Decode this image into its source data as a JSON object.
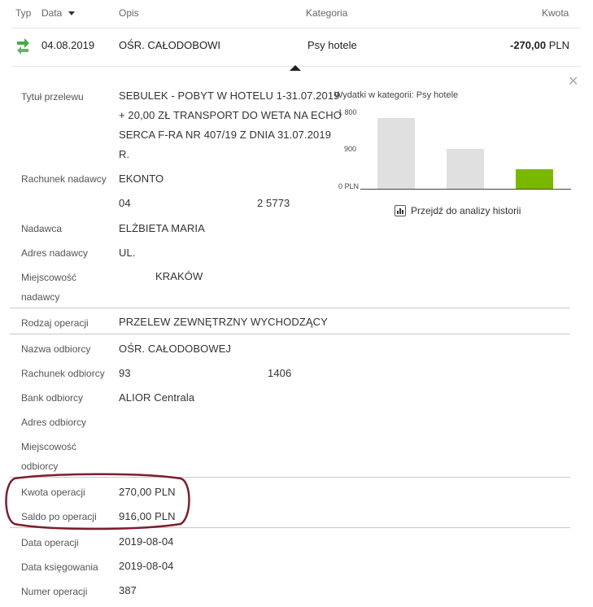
{
  "table_header": {
    "typ": "Typ",
    "data": "Data",
    "opis": "Opis",
    "kategoria": "Kategoria",
    "kwota": "Kwota"
  },
  "transaction": {
    "date": "04.08.2019",
    "description": "OŚR. CAŁODOBOWI",
    "category": "Psy hotele",
    "amount": "-270,00",
    "currency": "PLN",
    "icon": "transfer-arrows-icon"
  },
  "details": {
    "tytul": {
      "label": "Tytuł przelewu",
      "lines": [
        "SEBULEK - POBYT W HOTELU 1-31.07.2019",
        "+ 20,00 ZŁ TRANSPORT DO WETA NA ECHO",
        "SERCA F-RA NR 407/19 Z DNIA 31.07.2019",
        "R."
      ]
    },
    "rachunek_nadawcy": {
      "label": "Rachunek nadawcy",
      "line1": "EKONTO",
      "acc_start": "04",
      "acc_end": "2 5773"
    },
    "nadawca": {
      "label": "Nadawca",
      "value": "ELŻBIETA MARIA"
    },
    "adres_nadawcy": {
      "label": "Adres nadawcy",
      "value": "UL."
    },
    "miejscowosc_nadawcy": {
      "label_line1": "Miejscowość",
      "label_line2": "nadawcy",
      "value": "KRAKÓW"
    },
    "rodzaj_operacji": {
      "label": "Rodzaj operacji",
      "value": "PRZELEW ZEWNĘTRZNY WYCHODZĄCY"
    },
    "nazwa_odbiorcy": {
      "label": "Nazwa odbiorcy",
      "value": "OŚR. CAŁODOBOWEJ"
    },
    "rachunek_odbiorcy": {
      "label": "Rachunek odbiorcy",
      "acc_start": "93",
      "acc_end": "1406"
    },
    "bank_odbiorcy": {
      "label": "Bank odbiorcy",
      "value": "ALIOR Centrala"
    },
    "adres_odbiorcy": {
      "label": "Adres odbiorcy",
      "value": ""
    },
    "miejscowosc_odbiorcy": {
      "label_line1": "Miejscowość",
      "label_line2": "odbiorcy",
      "value": ""
    },
    "kwota_operacji": {
      "label": "Kwota operacji",
      "value": "270,00 PLN"
    },
    "saldo_po_operacji": {
      "label": "Saldo po operacji",
      "value": "916,00 PLN"
    },
    "data_operacji": {
      "label": "Data operacji",
      "value": "2019-08-04"
    },
    "data_ksiegowania": {
      "label": "Data księgowania",
      "value": "2019-08-04"
    },
    "numer_operacji": {
      "label": "Numer operacji",
      "value": "387"
    }
  },
  "chart_panel": {
    "title_prefix": "Wydatki w kategorii:",
    "title_category": "Psy hotele",
    "link_label": "Przejdź do analizy historii",
    "link_icon": "bar-chart-icon",
    "close_icon": "close-icon"
  },
  "chart_data": {
    "type": "bar",
    "categories": [
      "",
      "",
      ""
    ],
    "values": [
      1700,
      950,
      470
    ],
    "ylim": [
      0,
      1800
    ],
    "yticks": [
      "0 PLN",
      "900",
      "1 800"
    ],
    "grid": false,
    "colors": [
      "#e0e0e0",
      "#e0e0e0",
      "#7ab800"
    ]
  },
  "colors": {
    "accent_green": "#7ab800",
    "annotation_circle": "#7a1f2e"
  }
}
